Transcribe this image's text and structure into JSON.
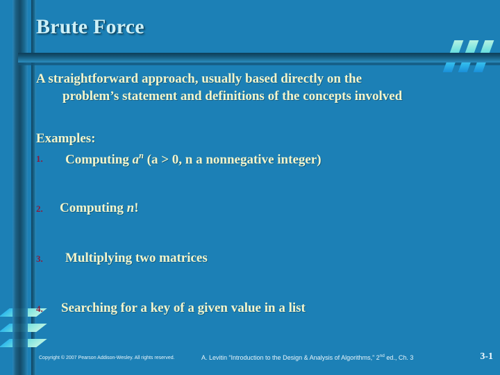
{
  "slide": {
    "title": "Brute Force",
    "background_color": "#1c80b6",
    "title_color": "#cdf0f7",
    "body_text_color": "#f2f5cc",
    "number_color": "#8e1838",
    "accent_color": "#6fe0df"
  },
  "intro": {
    "line1": "A straightforward approach, usually based directly on the",
    "line2": "problem’s statement and definitions of the concepts involved"
  },
  "examples": {
    "heading": "Examples:",
    "items": [
      {
        "number": "1.",
        "text_before": "Computing ",
        "base": "a",
        "exponent": "n",
        "text_after": " (a > 0, n a nonnegative integer)",
        "full_text": "Computing an (a > 0, n a nonnegative integer)"
      },
      {
        "number": "2.",
        "text_before": "Computing ",
        "variable": "n",
        "text_after": "!",
        "full_text": "Computing n!"
      },
      {
        "number": "3.",
        "full_text": "Multiplying two matrices"
      },
      {
        "number": "4.",
        "full_text": "Searching for a key of a given value in a list"
      }
    ]
  },
  "footer": {
    "copyright": "Copyright © 2007 Pearson Addison-Wesley. All rights reserved.",
    "attribution_part1": "A. Levitin “Introduction to the Design & Analysis of Algorithms,” 2",
    "attribution_ordinal": "nd",
    "attribution_part2": " ed., Ch. 3",
    "page_number": "3-1"
  },
  "decoration": {
    "top_right_slashes": "three-diagonal-slashes",
    "bottom_left_slashes": "three-horizontal-slashes"
  }
}
